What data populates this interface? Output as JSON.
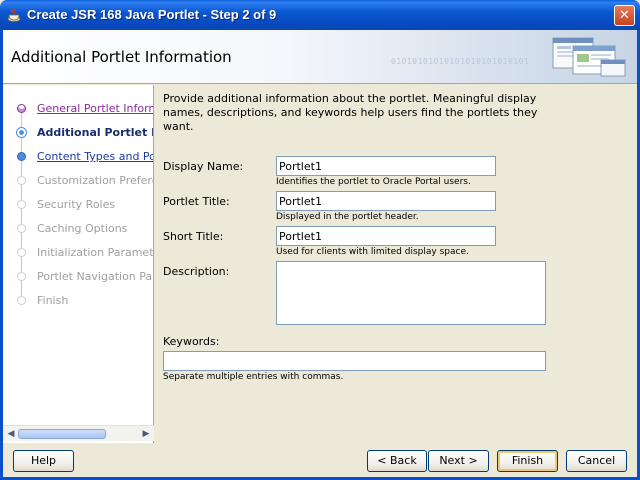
{
  "window": {
    "title": "Create JSR 168 Java Portlet - Step 2 of 9",
    "close_glyph": "✕"
  },
  "header": {
    "title": "Additional Portlet Information",
    "binary_text": "01010101010101010101010101"
  },
  "nav": {
    "items": [
      {
        "label": "General Portlet Informati",
        "state": "visited"
      },
      {
        "label": "Additional Portlet Inf",
        "state": "current"
      },
      {
        "label": "Content Types and Port",
        "state": "active"
      },
      {
        "label": "Customization Preferenc",
        "state": "disabled"
      },
      {
        "label": "Security Roles",
        "state": "disabled"
      },
      {
        "label": "Caching Options",
        "state": "disabled"
      },
      {
        "label": "Initialization Parameters",
        "state": "disabled"
      },
      {
        "label": "Portlet Navigation Paran",
        "state": "disabled"
      },
      {
        "label": "Finish",
        "state": "disabled"
      }
    ]
  },
  "main": {
    "intro": "Provide additional information about the portlet. Meaningful display names, descriptions, and keywords help users find the portlets they want.",
    "display_name": {
      "label": "Display Name:",
      "value": "Portlet1",
      "hint": "Identifies the portlet to Oracle Portal users."
    },
    "portlet_title": {
      "label": "Portlet Title:",
      "value": "Portlet1",
      "hint": "Displayed in the portlet header."
    },
    "short_title": {
      "label": "Short Title:",
      "value": "Portlet1",
      "hint": "Used for clients with limited display space."
    },
    "description": {
      "label": "Description:",
      "value": ""
    },
    "keywords": {
      "label": "Keywords:",
      "value": "",
      "hint": "Separate multiple entries with commas."
    }
  },
  "buttons": {
    "help": "Help",
    "back": "< Back",
    "next": "Next >",
    "finish": "Finish",
    "cancel": "Cancel"
  }
}
